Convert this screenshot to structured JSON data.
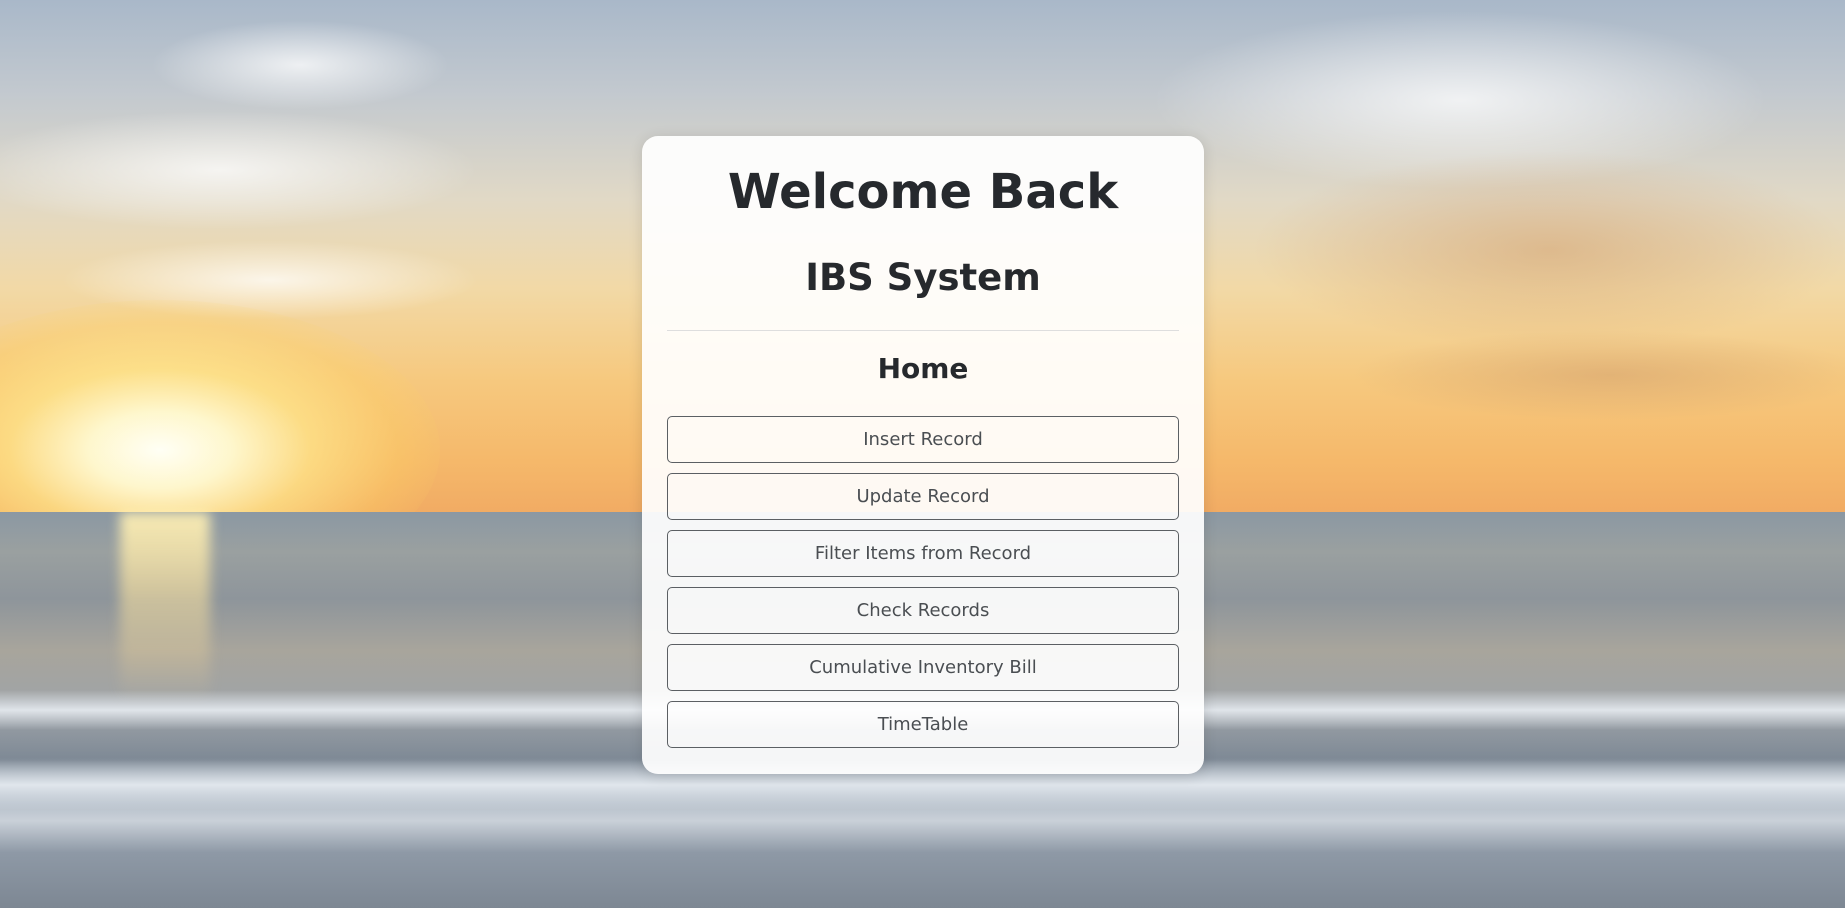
{
  "page": {
    "title": "Welcome Back",
    "subtitle": "IBS System",
    "section_heading": "Home"
  },
  "menu": {
    "items": [
      {
        "label": "Insert Record"
      },
      {
        "label": "Update Record"
      },
      {
        "label": "Filter Items from Record"
      },
      {
        "label": "Check Records"
      },
      {
        "label": "Cumulative Inventory Bill"
      },
      {
        "label": "TimeTable"
      }
    ]
  },
  "colors": {
    "card_background": "#ffffff",
    "text": "#26292d",
    "button_border": "#5b5f63",
    "button_text": "#4a4e52"
  }
}
